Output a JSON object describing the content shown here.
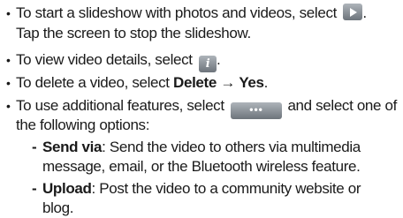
{
  "bullets": {
    "slideshow": {
      "line1_pre": "To start a slideshow with photos and videos, select ",
      "line1_post": ".",
      "line2": "Tap the screen to stop the slideshow.",
      "icon": "play-icon"
    },
    "details": {
      "pre": "To view video details, select ",
      "post": ".",
      "icon": "info-icon"
    },
    "delete": {
      "pre": "To delete a video, select ",
      "b1": "Delete",
      "arrow": " → ",
      "b2": "Yes",
      "post": "."
    },
    "additional": {
      "line1_pre": "To use additional features, select ",
      "line1_post": " and select one of",
      "line2": "the following options:",
      "icon": "more-icon"
    }
  },
  "options": [
    {
      "label": "Send via",
      "line1": ": Send the video to others via multimedia",
      "line2": "message, email, or the Bluetooth wireless feature."
    },
    {
      "label": "Upload",
      "line1": ": Post the video to a community website or",
      "line2": "blog."
    }
  ],
  "bullet_char": "•",
  "dash_char": "-",
  "more_icon_glyph": "•••",
  "info_icon_glyph": "i"
}
